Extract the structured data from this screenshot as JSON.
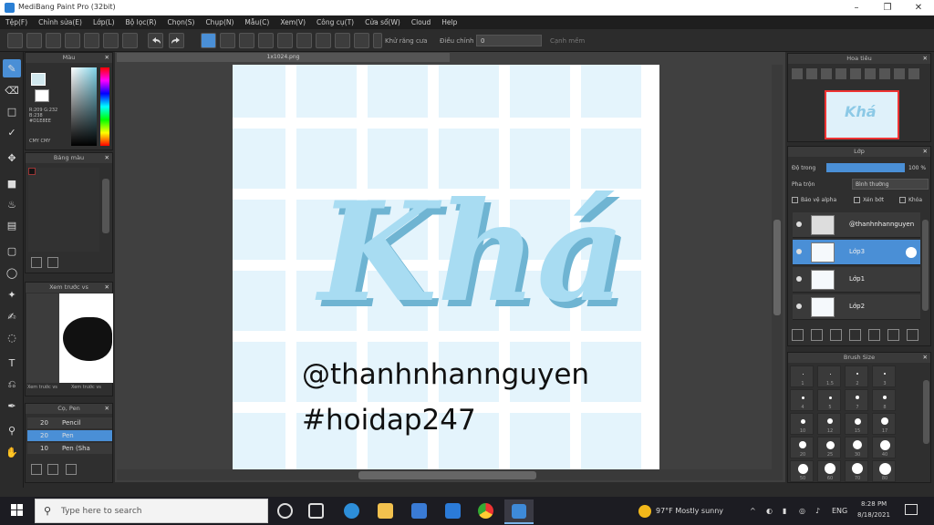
{
  "window": {
    "title": "MediBang Paint Pro (32bit)"
  },
  "menu": [
    "Tệp(F)",
    "Chỉnh sửa(E)",
    "Lớp(L)",
    "Bộ lọc(R)",
    "Chọn(S)",
    "Chụp(N)",
    "Mẫu(C)",
    "Xem(V)",
    "Công cụ(T)",
    "Cửa sổ(W)",
    "Cloud",
    "Help"
  ],
  "toolbar": {
    "auto_label": "Khử răng cưa",
    "adjust_label": "Điều chỉnh",
    "adjust_value": "0",
    "snap_label": "Cạnh mềm"
  },
  "color_panel": {
    "title": "Màu",
    "info": "R:209 G:232 B:238 #D1E8EE",
    "hex_label": "CMY CMY"
  },
  "palette_panel": {
    "title": "Bảng màu"
  },
  "navigator_left": {
    "title": "Xem trước vs",
    "btn1": "Xem trước vs",
    "btn2": "Xem trước vs"
  },
  "brush_list": {
    "title": "Cọ, Pen",
    "items": [
      {
        "size": "20",
        "name": "Pencil"
      },
      {
        "size": "20",
        "name": "Pen"
      },
      {
        "size": "10",
        "name": "Pen (Sha"
      }
    ]
  },
  "canvas": {
    "tab_title": "1x1024.png",
    "big_text": "Khá",
    "handle": "@thanhnhannguyen",
    "hashtag": "#hoidap247",
    "text_color": "#a8dcf2"
  },
  "navigator_right": {
    "title": "Hoa tiêu"
  },
  "layer_panel": {
    "title": "Lớp",
    "opacity_label": "Độ trong",
    "opacity_value": "100 %",
    "blend_label": "Pha trộn",
    "blend_value": "Bình thường",
    "protect_label": "Bảo vệ alpha",
    "clip_label": "Xén bớt",
    "lock_label": "Khóa",
    "layers": [
      {
        "name": "@thanhnhannguyen",
        "selected": false
      },
      {
        "name": "Lớp3",
        "selected": true
      },
      {
        "name": "Lớp1",
        "selected": false
      },
      {
        "name": "Lớp2",
        "selected": false
      }
    ]
  },
  "brush_size": {
    "title": "Brush Size",
    "labels": [
      "1",
      "1.5",
      "2",
      "3",
      "4",
      "5",
      "7",
      "8",
      "10",
      "12",
      "15",
      "17",
      "20",
      "25",
      "30",
      "40",
      "50",
      "60",
      "70",
      "80"
    ]
  },
  "taskbar": {
    "search_placeholder": "Type here to search",
    "weather": "97°F  Mostly sunny",
    "lang": "ENG",
    "time": "8:28 PM",
    "date": "8/18/2021"
  },
  "colors": {
    "accent": "#4a8fd6",
    "canvas_bg": "#404040",
    "tile": "#e4f4fc"
  }
}
